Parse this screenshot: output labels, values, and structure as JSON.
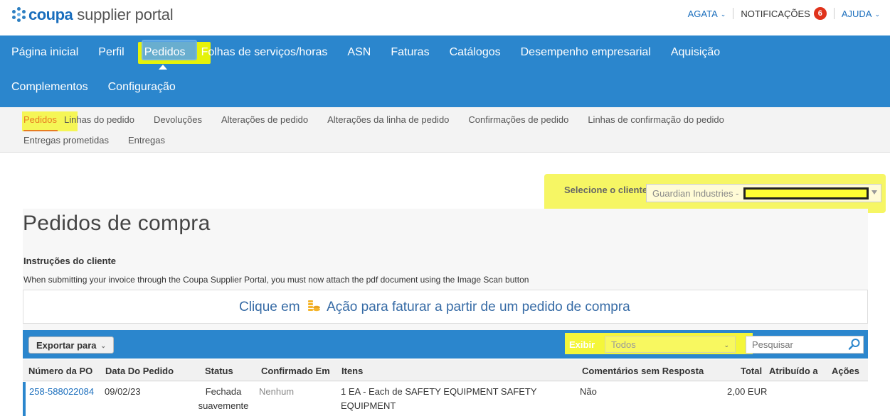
{
  "header": {
    "logo_word": "coupa",
    "logo_rest": "supplier portal",
    "user_label": "AGATA",
    "notifications_label": "NOTIFICAÇÕES",
    "notifications_count": "6",
    "help_label": "AJUDA"
  },
  "primary_nav": {
    "row1": [
      "Página inicial",
      "Perfil",
      "Pedidos",
      "Folhas de serviços/horas",
      "ASN",
      "Faturas",
      "Catálogos",
      "Desempenho empresarial",
      "Aquisição"
    ],
    "row2": [
      "Complementos",
      "Configuração"
    ],
    "active": "Pedidos"
  },
  "secondary_nav": {
    "row1": [
      "Pedidos",
      "Linhas do pedido",
      "Devoluções",
      "Alterações de pedido",
      "Alterações da linha de pedido",
      "Confirmações de pedido",
      "Linhas de confirmação do pedido"
    ],
    "row2": [
      "Entregas prometidas",
      "Entregas"
    ],
    "active": "Pedidos"
  },
  "customer": {
    "label": "Selecione o cliente",
    "selected": "Guardian Industries -"
  },
  "page": {
    "title": "Pedidos de compra",
    "instructions_heading": "Instruções do cliente",
    "instructions_text": "When submitting your invoice through the Coupa Supplier Portal, you must now attach the pdf document using the Image Scan button",
    "callout_pre": "Clique em",
    "callout_post": "Ação para faturar a partir de um pedido de compra"
  },
  "table_bar": {
    "export_label": "Exportar para",
    "show_label": "Exibir",
    "show_value": "Todos",
    "search_placeholder": "Pesquisar"
  },
  "table": {
    "columns": [
      "Número da PO",
      "Data Do Pedido",
      "Status",
      "Confirmado Em",
      "Itens",
      "Comentários sem Resposta",
      "Total",
      "Atribuído a",
      "Ações"
    ],
    "rows": [
      {
        "po": "258-588022084",
        "date": "09/02/23",
        "status_line1": "Fechada",
        "status_line2": "suavemente",
        "confirmed": "Nenhum",
        "items_line1": "1 EA - Each de SAFETY EQUIPMENT SAFETY",
        "items_line2": "EQUIPMENT",
        "comments": "Não",
        "total": "2,00 EUR",
        "assigned": "",
        "actions": ""
      }
    ]
  },
  "colors": {
    "brand_blue": "#2b86cd",
    "active_orange": "#e77c22",
    "highlight_yellow": "#f4f63a",
    "badge_red": "#e0321b"
  }
}
